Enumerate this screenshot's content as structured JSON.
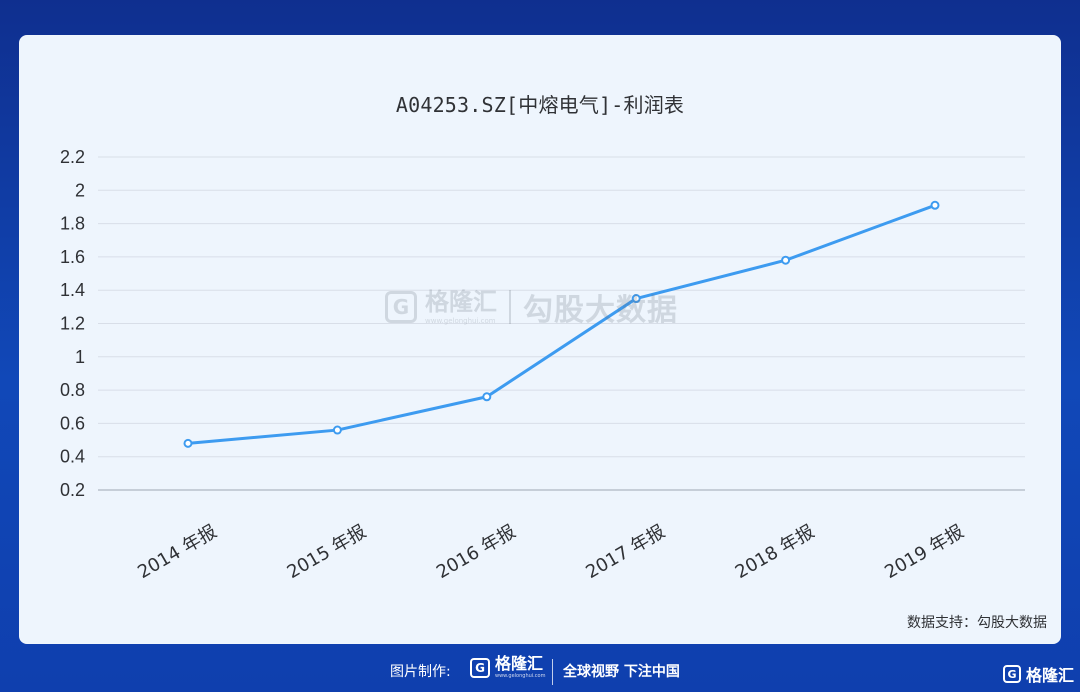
{
  "footer": {
    "made_by": "图片制作:",
    "brand": "格隆汇",
    "brand_url": "www.gelonghui.com",
    "slogan": "全球视野 下注中国"
  },
  "watermark": {
    "brand": "格隆汇",
    "url": "www.gelonghui.com",
    "partner": "勾股大数据"
  },
  "source_label": "数据支持：勾股大数据",
  "chart_data": {
    "type": "line",
    "title": "A04253.SZ[中熔电气]-利润表",
    "categories": [
      "2014 年报",
      "2015 年报",
      "2016 年报",
      "2017 年报",
      "2018 年报",
      "2019 年报"
    ],
    "series": [
      {
        "values": [
          0.48,
          0.56,
          0.76,
          1.35,
          1.58,
          1.91
        ],
        "color": "#3d9bf0"
      }
    ],
    "ylim": [
      0.2,
      2.2
    ],
    "yticks": [
      "0.2",
      "0.4",
      "0.6",
      "0.8",
      "1",
      "1.2",
      "1.4",
      "1.6",
      "1.8",
      "2",
      "2.2"
    ],
    "grid": true,
    "legend": "none"
  }
}
